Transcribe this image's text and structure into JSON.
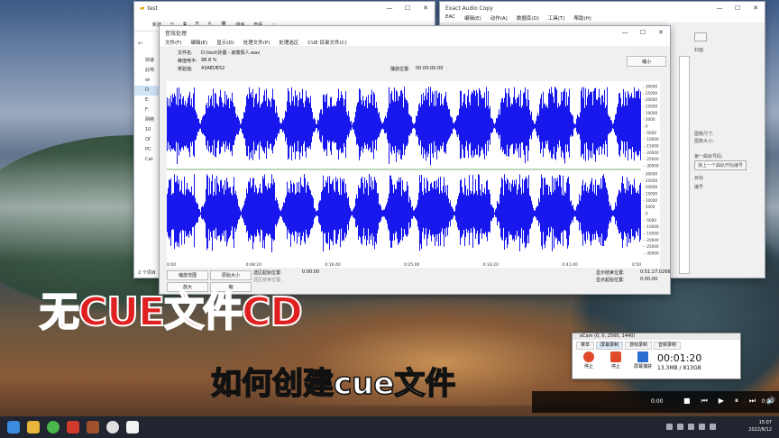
{
  "explorer": {
    "title": "test",
    "ribbon": [
      "新建",
      "✂",
      "⧉",
      "⎘",
      "⇱",
      "🗑",
      "排序",
      "查看",
      "···"
    ],
    "nav_items": [
      "快速",
      "此电",
      "wi",
      "D:",
      "E:",
      "F:",
      "网络",
      "10",
      "Of",
      "PC",
      "Cat"
    ],
    "status": "2 个项目"
  },
  "eac": {
    "title": "Exact Audio Copy",
    "menu": [
      "EAC",
      "编辑(E)",
      "动作(A)",
      "数据库(D)",
      "工具(T)",
      "帮助(H)"
    ],
    "right_panel": [
      "&nbsp;",
      "封面",
      "图像尺寸:",
      "图像大小:",
      "第一曲目号码:",
      "接上一个曲轨开始编号",
      "目标",
      "编号"
    ]
  },
  "editor": {
    "title": "音效处理",
    "menu": [
      "文件(F)",
      "编辑(E)",
      "显示(D)",
      "处理文件(P)",
      "处理选区",
      "CUE 目录文件(C)"
    ],
    "file_label": "文件名:",
    "file_value": "D:\\test\\孙露 - 寂寞情人.wav",
    "level_label": "峰值电平:",
    "level_value": "98.8 %",
    "checksum_label": "校验值:",
    "checksum_value": "43AEDE52",
    "play_pos_label": "播放位置:",
    "play_pos_value": "00:00:00.00",
    "shrink_button": "缩小",
    "time_axis": [
      "0:00",
      "0:08:20",
      "0:16:40",
      "0:25:00",
      "0:33:20",
      "0:41:40",
      "0:50"
    ],
    "amp_axis": [
      "30000",
      "25000",
      "20000",
      "15000",
      "10000",
      "5000",
      "0",
      "-5000",
      "-10000",
      "-15000",
      "-20000",
      "-25000",
      "-30000"
    ],
    "btn_zoom_range": "缩放范围",
    "btn_orig_size": "原始大小",
    "btn_enlarge": "放大",
    "btn_small": "缩",
    "sel_start_label": "选区起始位置:",
    "sel_start_value": "0:00:00",
    "sel_end_label": "选区结束位置:",
    "disp_end_label": "显示结束位置:",
    "disp_end_value": "0:51:27.0266",
    "disp_start_label": "显示起始位置:",
    "disp_start_value": "0:00:00"
  },
  "caption": {
    "main": "无CUE文件CD",
    "sub": "如何创建cue文件"
  },
  "ocam": {
    "title": "oCam (0, 0, 2560, 1440)",
    "tabs": [
      "菜单",
      "屏幕录制",
      "游戏录制",
      "音频录制"
    ],
    "tools": [
      "停止",
      "停止",
      "屏幕捕获"
    ],
    "time": "00:01:20",
    "size": "13.3MB / 813GB"
  },
  "player": {
    "current": "0:00",
    "duration": "0:00"
  },
  "taskbar": {
    "time": "15:07",
    "date": "2022/8/12"
  }
}
